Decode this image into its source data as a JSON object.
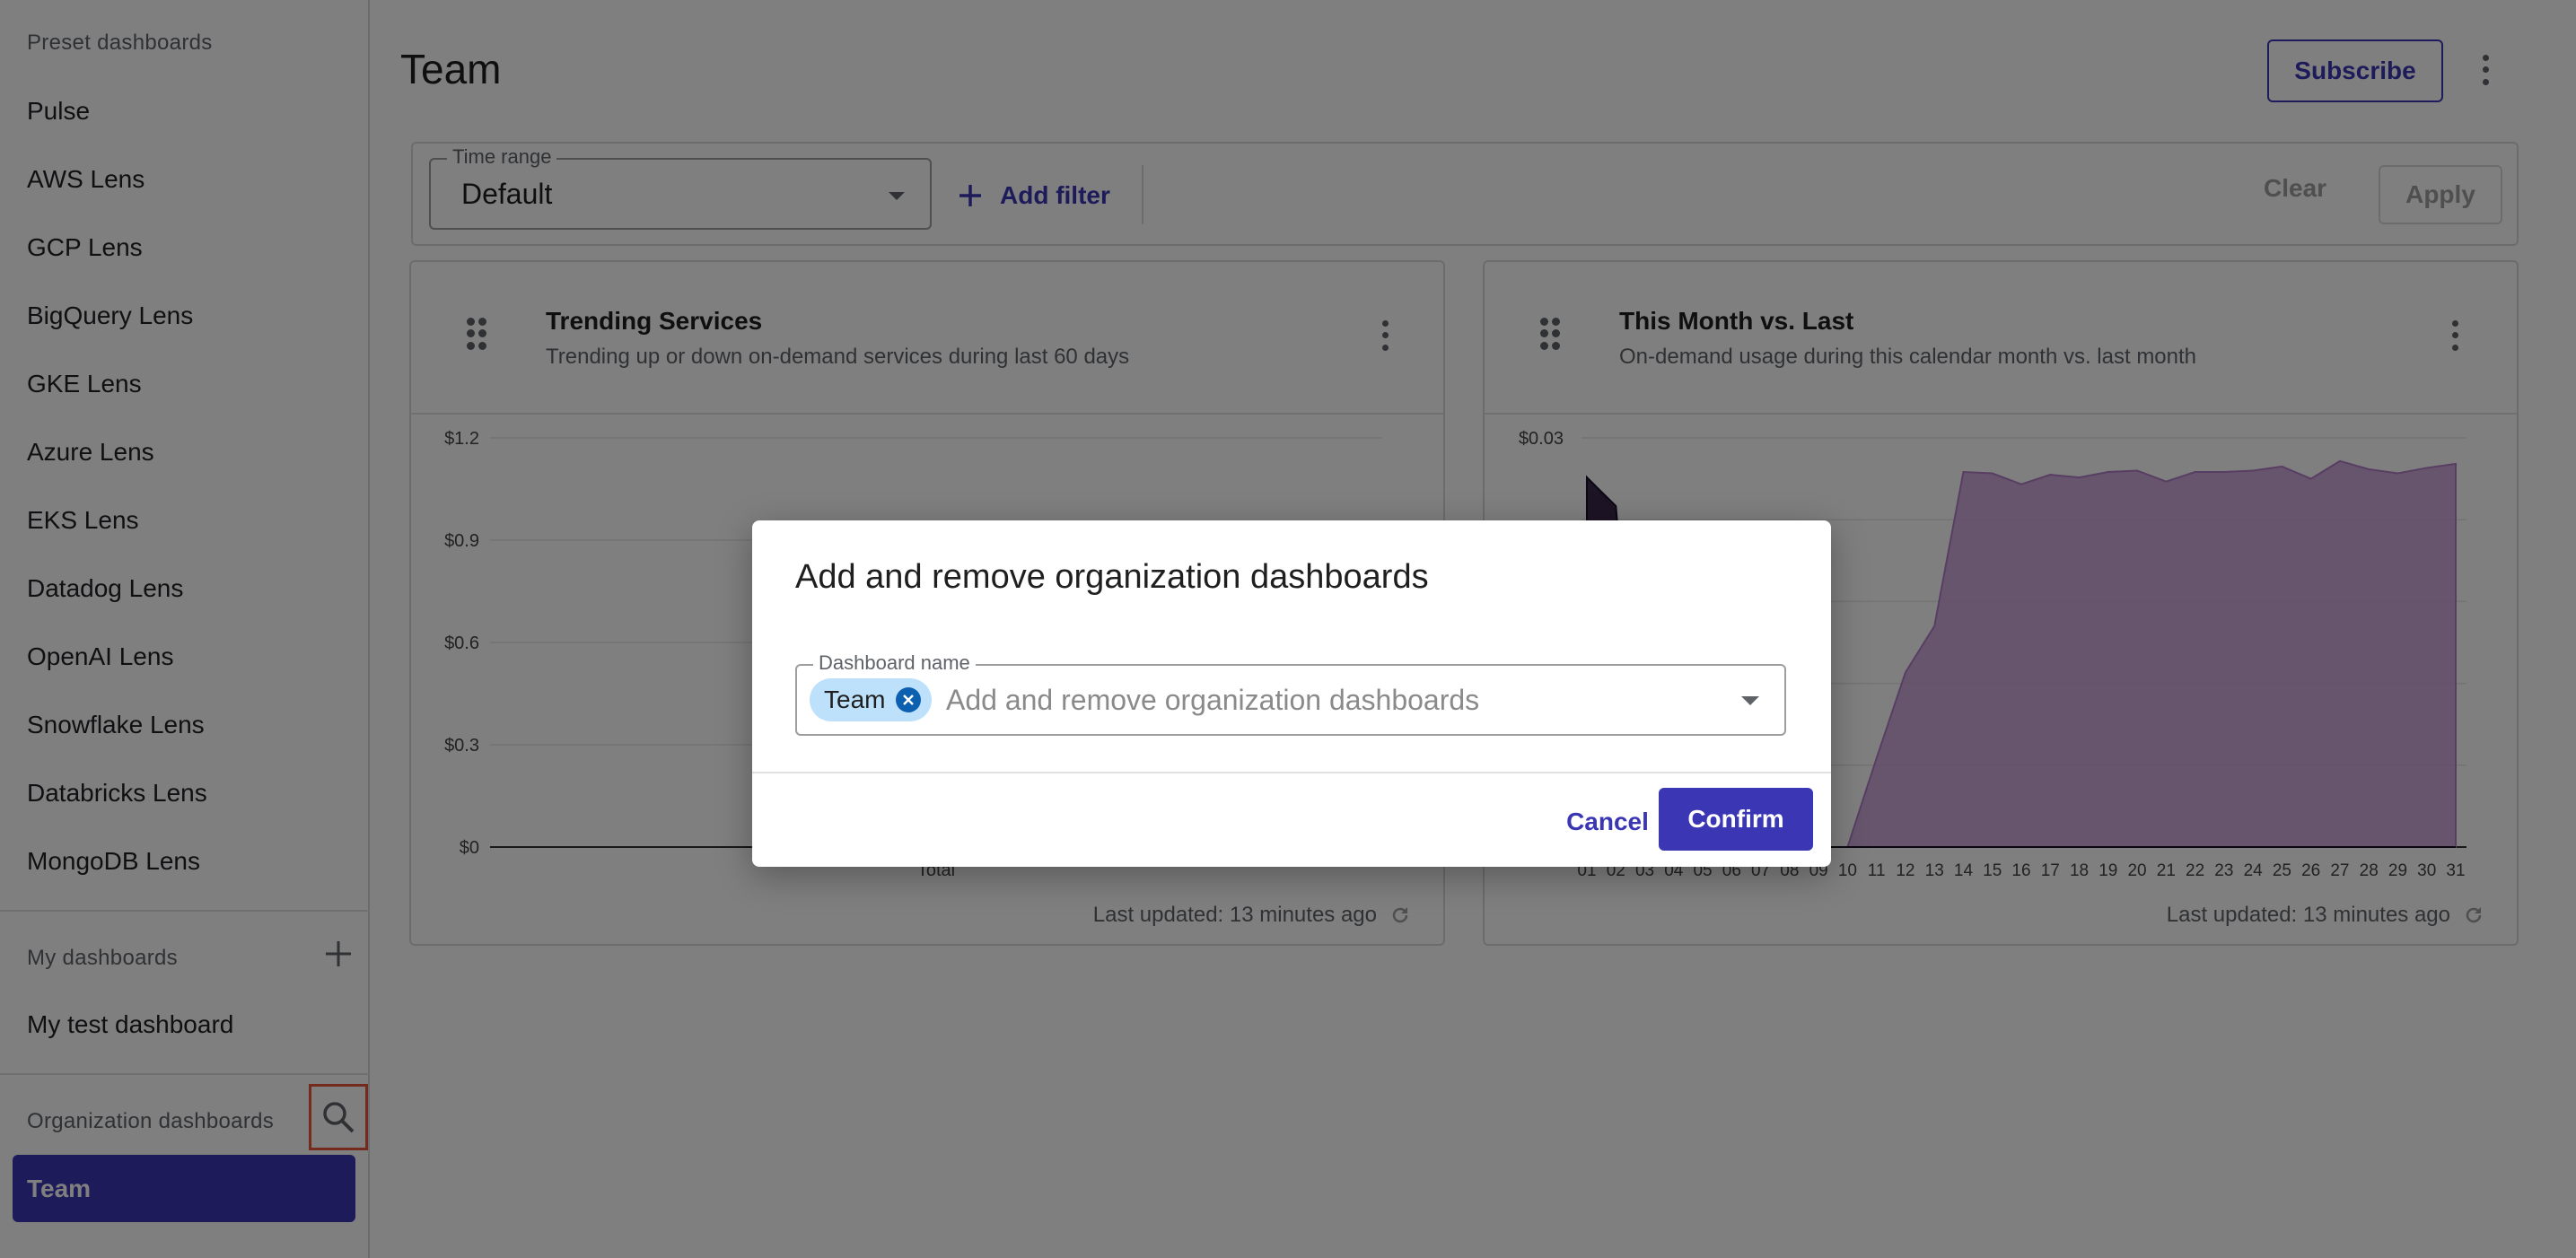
{
  "sidebar": {
    "preset_label": "Preset dashboards",
    "preset_items": [
      "Pulse",
      "AWS Lens",
      "GCP Lens",
      "BigQuery Lens",
      "GKE Lens",
      "Azure Lens",
      "EKS Lens",
      "Datadog Lens",
      "OpenAI Lens",
      "Snowflake Lens",
      "Databricks Lens",
      "MongoDB Lens"
    ],
    "my_label": "My dashboards",
    "my_items": [
      "My test dashboard"
    ],
    "org_label": "Organization dashboards",
    "org_items": [
      "Team"
    ]
  },
  "header": {
    "title": "Team",
    "subscribe_label": "Subscribe"
  },
  "filters": {
    "time_range_label": "Time range",
    "time_range_value": "Default",
    "add_filter_label": "Add filter",
    "clear_label": "Clear",
    "apply_label": "Apply"
  },
  "cards": {
    "trending": {
      "title": "Trending Services",
      "subtitle": "Trending up or down on-demand services during last 60 days",
      "footer": "Last updated: 13 minutes ago"
    },
    "month": {
      "title": "This Month vs. Last",
      "subtitle": "On-demand usage during this calendar month vs. last month",
      "footer": "Last updated: 13 minutes ago"
    }
  },
  "dialog": {
    "title": "Add and remove organization dashboards",
    "field_label": "Dashboard name",
    "chip_label": "Team",
    "placeholder": "Add and remove organization dashboards",
    "cancel_label": "Cancel",
    "confirm_label": "Confirm"
  },
  "colors": {
    "accent": "#3a36b4",
    "area": "#c39bd3",
    "area_dark": "#2a1a3a",
    "chip": "#bde0fb"
  },
  "chart_data": [
    {
      "type": "bar",
      "title": "Trending Services",
      "categories": [
        "Total"
      ],
      "values": [
        0
      ],
      "yticks": [
        "$0",
        "$0.3",
        "$0.6",
        "$0.9",
        "$1.2"
      ],
      "ylim": [
        0,
        1.2
      ]
    },
    {
      "type": "area",
      "title": "This Month vs. Last",
      "x": [
        "01",
        "02",
        "03",
        "04",
        "05",
        "06",
        "07",
        "08",
        "09",
        "10",
        "11",
        "12",
        "13",
        "14",
        "15",
        "16",
        "17",
        "18",
        "19",
        "20",
        "21",
        "22",
        "23",
        "24",
        "25",
        "26",
        "27",
        "28",
        "29",
        "30",
        "31"
      ],
      "yticks": [
        "$0.03"
      ],
      "ylim": [
        0,
        0.03
      ],
      "series": [
        {
          "values": [
            0.0271,
            0.0246,
            0,
            0,
            0,
            0,
            0,
            0,
            0,
            0,
            0.0065,
            0.0128,
            0.0162,
            0.0275,
            0.0274,
            0.0266,
            0.0273,
            0.0271,
            0.0275,
            0.0276,
            0.0268,
            0.0275,
            0.0275,
            0.0276,
            0.0279,
            0.027,
            0.0283,
            0.0277,
            0.0274,
            0.0278,
            0.0281
          ]
        },
        {
          "values": [
            0.0271,
            0.025,
            0,
            0,
            0,
            0,
            0,
            0,
            0,
            0,
            0,
            0,
            0,
            0,
            0,
            0,
            0,
            0,
            0,
            0,
            0,
            0,
            0,
            0,
            0,
            0,
            0,
            0,
            0,
            0,
            0
          ]
        }
      ]
    }
  ]
}
